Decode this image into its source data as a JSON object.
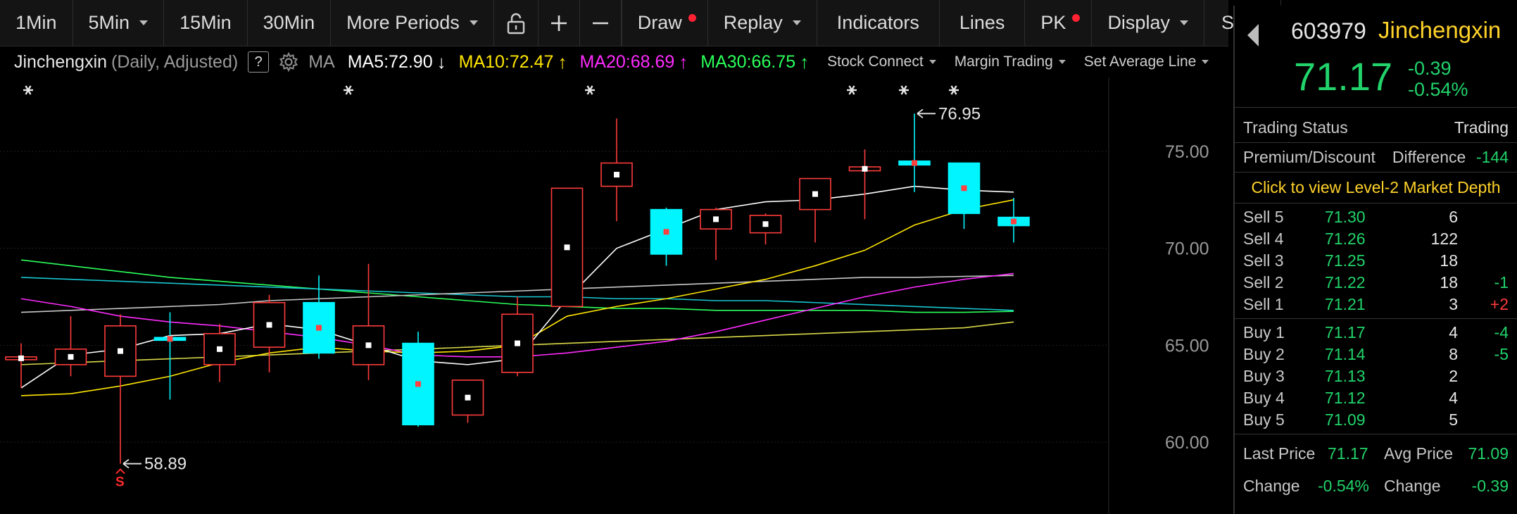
{
  "toolbar": {
    "items": [
      "1Min",
      "5Min",
      "15Min",
      "30Min",
      "More Periods",
      "Draw",
      "Replay",
      "Indicators",
      "Lines",
      "PK",
      "Display",
      "Style"
    ]
  },
  "indicator_bar": {
    "name": "Jinchengxin",
    "period": "(Daily, Adjusted)",
    "help": "?",
    "ma_label": "MA",
    "ma5": "MA5:72.90",
    "ma5_arrow": "↓",
    "ma10": "MA10:72.47",
    "ma10_arrow": "↑",
    "ma20": "MA20:68.69",
    "ma20_arrow": "↑",
    "ma30": "MA30:66.75",
    "ma30_arrow": "↑",
    "menus": [
      "Stock Connect",
      "Margin Trading",
      "Set Average Line"
    ],
    "colors": {
      "ma5": "#ffffff",
      "ma10": "#ffe600",
      "ma20": "#ff2bff",
      "ma30": "#2bff5a"
    }
  },
  "chart_data": {
    "type": "candlestick",
    "y_ticks": [
      "75.00",
      "70.00",
      "65.00",
      "60.00"
    ],
    "y_tick_values": [
      75,
      70,
      65,
      60
    ],
    "ylim": [
      57.5,
      79.5
    ],
    "annotations": {
      "high": "76.95",
      "low": "58.89",
      "low_marker": "S"
    },
    "candles": [
      {
        "o": 64.4,
        "h": 65.1,
        "l": 62.8,
        "c": 64.4
      },
      {
        "o": 64.0,
        "h": 66.5,
        "l": 63.4,
        "c": 64.8
      },
      {
        "o": 63.4,
        "h": 66.6,
        "l": 58.89,
        "c": 66.0
      },
      {
        "o": 65.4,
        "h": 66.7,
        "l": 62.2,
        "c": 65.3
      },
      {
        "o": 64.0,
        "h": 66.1,
        "l": 63.1,
        "c": 65.6
      },
      {
        "o": 64.9,
        "h": 67.6,
        "l": 63.6,
        "c": 67.2
      },
      {
        "o": 67.2,
        "h": 68.6,
        "l": 64.3,
        "c": 64.6
      },
      {
        "o": 64.0,
        "h": 69.2,
        "l": 63.2,
        "c": 66.0
      },
      {
        "o": 65.1,
        "h": 65.7,
        "l": 60.8,
        "c": 60.9
      },
      {
        "o": 61.4,
        "h": 63.0,
        "l": 61.0,
        "c": 63.2
      },
      {
        "o": 63.6,
        "h": 67.5,
        "l": 63.4,
        "c": 66.6
      },
      {
        "o": 67.0,
        "h": 73.1,
        "l": 67.0,
        "c": 73.1
      },
      {
        "o": 73.2,
        "h": 76.7,
        "l": 71.4,
        "c": 74.4
      },
      {
        "o": 72.0,
        "h": 72.1,
        "l": 69.1,
        "c": 69.7
      },
      {
        "o": 71.0,
        "h": 72.1,
        "l": 69.4,
        "c": 72.0
      },
      {
        "o": 70.8,
        "h": 71.8,
        "l": 70.2,
        "c": 71.7
      },
      {
        "o": 72.0,
        "h": 73.6,
        "l": 70.3,
        "c": 73.6
      },
      {
        "o": 74.0,
        "h": 75.1,
        "l": 71.5,
        "c": 74.2
      },
      {
        "o": 74.5,
        "h": 76.95,
        "l": 72.9,
        "c": 74.3
      },
      {
        "o": 74.4,
        "h": 74.4,
        "l": 71.0,
        "c": 71.8
      },
      {
        "o": 71.6,
        "h": 72.6,
        "l": 70.3,
        "c": 71.17
      }
    ],
    "ma_lines": {
      "ma5": [
        62.8,
        64.5,
        64.8,
        65.5,
        65.6,
        66.1,
        65.8,
        65.0,
        64.2,
        64.0,
        64.3,
        67.4,
        70.0,
        71.0,
        72.0,
        72.4,
        72.5,
        72.8,
        73.2,
        73.0,
        72.9
      ],
      "ma10": [
        62.4,
        62.5,
        62.9,
        63.4,
        64.1,
        64.6,
        64.9,
        64.7,
        64.6,
        64.7,
        65.0,
        66.5,
        67.0,
        67.4,
        67.9,
        68.4,
        69.1,
        69.9,
        71.2,
        72.0,
        72.5
      ],
      "ma20": [
        67.4,
        67.0,
        66.5,
        66.2,
        66.0,
        65.7,
        65.4,
        65.0,
        64.5,
        64.4,
        64.4,
        64.6,
        64.9,
        65.2,
        65.7,
        66.3,
        66.9,
        67.5,
        68.0,
        68.4,
        68.7
      ],
      "ma30": [
        69.4,
        69.1,
        68.8,
        68.5,
        68.3,
        68.1,
        67.9,
        67.7,
        67.5,
        67.3,
        67.1,
        67.0,
        66.9,
        66.9,
        66.8,
        66.8,
        66.8,
        66.8,
        66.7,
        66.7,
        66.75
      ],
      "teal": [
        68.5,
        68.4,
        68.3,
        68.2,
        68.1,
        68.0,
        67.9,
        67.8,
        67.7,
        67.6,
        67.5,
        67.5,
        67.4,
        67.4,
        67.3,
        67.3,
        67.2,
        67.1,
        67.0,
        66.9,
        66.8
      ],
      "grey": [
        66.7,
        66.8,
        66.9,
        67.0,
        67.1,
        67.3,
        67.4,
        67.5,
        67.6,
        67.7,
        67.8,
        67.9,
        68.0,
        68.1,
        68.2,
        68.3,
        68.4,
        68.5,
        68.5,
        68.55,
        68.6
      ],
      "olive": [
        64.0,
        64.1,
        64.2,
        64.3,
        64.4,
        64.5,
        64.6,
        64.7,
        64.8,
        64.9,
        65.0,
        65.1,
        65.2,
        65.3,
        65.4,
        65.5,
        65.6,
        65.7,
        65.8,
        65.9,
        66.2
      ]
    },
    "colors": {
      "up": "#ff3b3b",
      "down": "#00f5ff",
      "ma5": "#ffffff",
      "ma10": "#ffe600",
      "ma20": "#ff2bff",
      "ma30": "#2bff5a",
      "teal": "#18c6d0",
      "grey": "#c8c8c8",
      "olive": "#d8d84a"
    }
  },
  "panel": {
    "code": "603979",
    "name": "Jinchengxin",
    "price": "71.17",
    "change": "-0.39",
    "change_pct": "-0.54%",
    "status_label": "Trading Status",
    "status_value": "Trading",
    "premium_label": "Premium/Discount",
    "difference_label": "Difference",
    "difference_value": "-144",
    "level2_link": "Click to view Level-2 Market Depth",
    "sells": [
      {
        "label": "Sell 5",
        "price": "71.30",
        "vol": "6",
        "chg": "",
        "chg_color": ""
      },
      {
        "label": "Sell 4",
        "price": "71.26",
        "vol": "122",
        "chg": "",
        "chg_color": ""
      },
      {
        "label": "Sell 3",
        "price": "71.25",
        "vol": "18",
        "chg": "",
        "chg_color": ""
      },
      {
        "label": "Sell 2",
        "price": "71.22",
        "vol": "18",
        "chg": "-1",
        "chg_color": "green"
      },
      {
        "label": "Sell 1",
        "price": "71.21",
        "vol": "3",
        "chg": "+2",
        "chg_color": "red"
      }
    ],
    "buys": [
      {
        "label": "Buy 1",
        "price": "71.17",
        "vol": "4",
        "chg": "-4",
        "chg_color": "green"
      },
      {
        "label": "Buy 2",
        "price": "71.14",
        "vol": "8",
        "chg": "-5",
        "chg_color": "green"
      },
      {
        "label": "Buy 3",
        "price": "71.13",
        "vol": "2",
        "chg": "",
        "chg_color": ""
      },
      {
        "label": "Buy 4",
        "price": "71.12",
        "vol": "4",
        "chg": "",
        "chg_color": ""
      },
      {
        "label": "Buy 5",
        "price": "71.09",
        "vol": "5",
        "chg": "",
        "chg_color": ""
      }
    ],
    "last_price_label": "Last Price",
    "last_price": "71.17",
    "avg_price_label": "Avg Price",
    "avg_price": "71.09",
    "change_label_1": "Change",
    "change_pct_value": "-0.54%",
    "change_label_2": "Change",
    "change_value": "-0.39"
  }
}
